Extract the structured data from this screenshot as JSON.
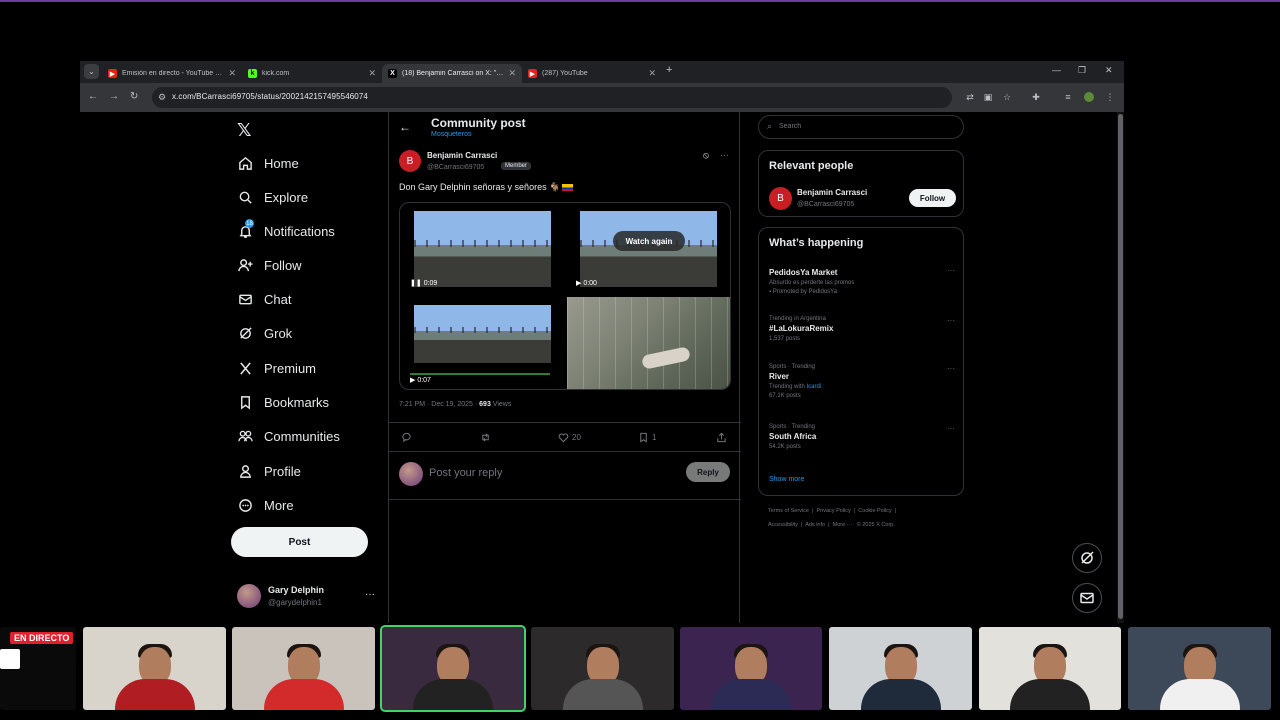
{
  "browser": {
    "tabs": [
      {
        "label": "Emisión en directo - YouTube Studio",
        "active": false
      },
      {
        "label": "kick.com",
        "active": false
      },
      {
        "label": "(18) Benjamin Carrasci on X: \"Don",
        "active": true
      },
      {
        "label": "(287) YouTube",
        "active": false
      }
    ],
    "url": "x.com/BCarrasci69705/status/2002142157495546074"
  },
  "sidebar": {
    "items": [
      {
        "label": "Home",
        "icon": "home-icon"
      },
      {
        "label": "Explore",
        "icon": "search-icon"
      },
      {
        "label": "Notifications",
        "icon": "bell-icon",
        "badge": "18"
      },
      {
        "label": "Follow",
        "icon": "add-person-icon"
      },
      {
        "label": "Chat",
        "icon": "mail-icon"
      },
      {
        "label": "Grok",
        "icon": "grok-icon"
      },
      {
        "label": "Premium",
        "icon": "x-icon"
      },
      {
        "label": "Bookmarks",
        "icon": "bookmark-icon"
      },
      {
        "label": "Communities",
        "icon": "communities-icon"
      },
      {
        "label": "Profile",
        "icon": "person-icon"
      },
      {
        "label": "More",
        "icon": "more-circle-icon"
      }
    ],
    "post_label": "Post",
    "account": {
      "name": "Gary Delphin",
      "handle": "@garydelphin1"
    }
  },
  "main": {
    "title": "Community post",
    "subtitle": "Mosqueteros",
    "post": {
      "author": "Benjamin Carrasci",
      "handle": "@BCarrasci69705",
      "member_label": "Member",
      "text": "Don Gary Delphin señoras y señores 🐐",
      "media": {
        "video1_time": "0:09",
        "video2_time": "0:00",
        "video2_overlay": "Watch again",
        "video3_time": "0:07"
      },
      "timestamp": "7:21 PM · Dec 19, 2025 · ",
      "views_count": "693",
      "views_label": " Views",
      "likes": "20",
      "bookmarks": "1"
    },
    "reply_placeholder": "Post your reply",
    "reply_button": "Reply"
  },
  "right": {
    "search_placeholder": "Search",
    "relevant_title": "Relevant people",
    "relevant_person": {
      "name": "Benjamin Carrasci",
      "handle": "@BCarrasci69705",
      "follow_label": "Follow"
    },
    "happening_title": "What’s happening",
    "trends": [
      {
        "context": "",
        "title": "PedidosYa Market",
        "line2": "Absurdo es perderte las promos",
        "line3": "Promoted by PedidosYa"
      },
      {
        "context": "Trending in Argentina",
        "title": "#LaLokuraRemix",
        "line2": "1,537 posts",
        "line3": ""
      },
      {
        "context": "Sports · Trending",
        "title": "River",
        "line2": "Trending with ",
        "link": "Icardi",
        "line3": "67.1K posts"
      },
      {
        "context": "Sports · Trending",
        "title": "South Africa",
        "line2": "54.2K posts",
        "line3": ""
      }
    ],
    "show_more": "Show more",
    "footer": [
      "Terms of Service",
      "Privacy Policy",
      "Cookie Policy",
      "Accessibility",
      "Ads info",
      "More ···",
      "© 2025 X Corp."
    ]
  },
  "stream": {
    "live_label": "EN DIRECTO"
  }
}
